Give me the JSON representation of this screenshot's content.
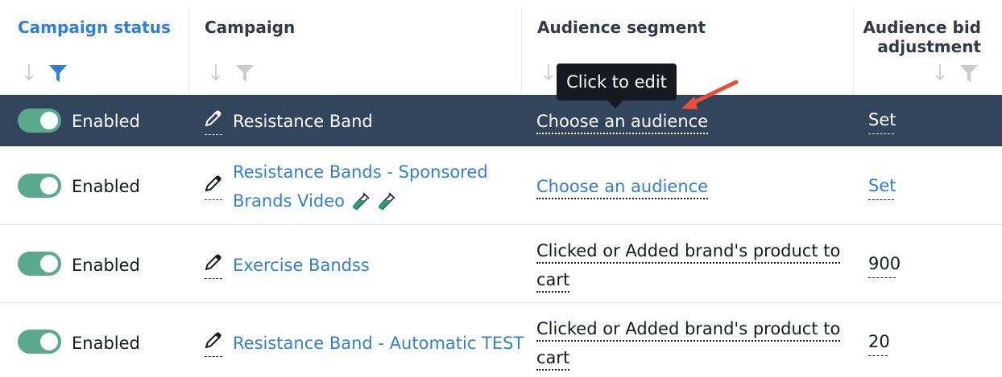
{
  "columns": {
    "status": "Campaign status",
    "campaign": "Campaign",
    "audience": "Audience segment",
    "bid_line1": "Audience bid",
    "bid_line2": "adjustment"
  },
  "tooltip": "Click to edit",
  "rows": [
    {
      "status": "Enabled",
      "campaign": "Resistance Band",
      "audience": "Choose an audience",
      "bid": "Set"
    },
    {
      "status": "Enabled",
      "campaign_line1": "Resistance Bands - Sponsored",
      "campaign_line2": "Brands Video",
      "audience": "Choose an audience",
      "bid": "Set"
    },
    {
      "status": "Enabled",
      "campaign": "Exercise Bandss",
      "audience_line1": "Clicked or Added brand's product to",
      "audience_line2": "cart",
      "bid": "900"
    },
    {
      "status": "Enabled",
      "campaign": "Resistance Band - Automatic TEST",
      "audience_line1": "Clicked or Added brand's product to",
      "audience_line2": "cart",
      "bid": "20"
    }
  ],
  "colors": {
    "header_active": "#2f7fd6",
    "selected_row": "#33455c",
    "toggle_on": "#5aa98b",
    "link": "#2f7fd6",
    "annotation_arrow": "#e8503a",
    "test_tube": "#2e9b7e"
  },
  "icons": [
    "sort-down-icon",
    "filter-icon",
    "pencil-icon",
    "test-tube-icon",
    "annotation-arrow-icon"
  ]
}
